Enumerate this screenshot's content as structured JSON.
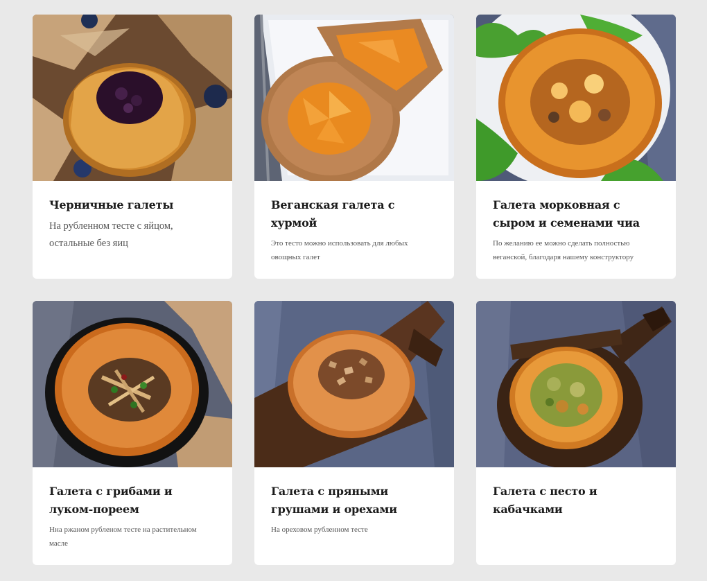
{
  "recipes": [
    {
      "title": "Черничные галеты",
      "description": "На рубленном тесте с яйцом, остальные без яиц",
      "image_icon": "blueberry-galette-photo"
    },
    {
      "title": "Веганская галета с хурмой",
      "description": "Это тесто можно использовать для любых овощных галет",
      "image_icon": "persimmon-galette-photo"
    },
    {
      "title": "Галета морковная с сыром и семенами чиа",
      "description": "По желанию ее можно сделать полностью веганской, благодаря нашему конструктору",
      "image_icon": "carrot-galette-photo"
    },
    {
      "title": "Галета с грибами и луком-пореем",
      "description": "Нна ржаном рубленом тесте на растительном масле",
      "image_icon": "mushroom-galette-photo"
    },
    {
      "title": "Галета с пряными грушами и орехами",
      "description": "На ореховом рубленном тесте",
      "image_icon": "pear-nut-galette-photo"
    },
    {
      "title": "Галета с песто и кабачками",
      "description": "",
      "image_icon": "pesto-zucchini-galette-photo"
    }
  ],
  "colors": {
    "page_background": "#e9e9e9",
    "card_background": "#ffffff",
    "title_text": "#1b1b1b",
    "description_text": "#555555"
  }
}
